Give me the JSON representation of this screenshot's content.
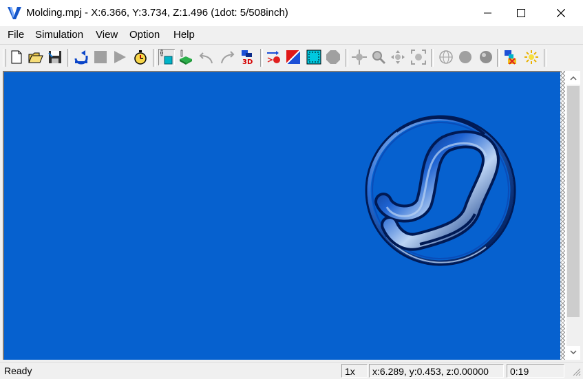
{
  "window": {
    "title": "Molding.mpj - X:6.366, Y:3.734, Z:1.496 (1dot: 5/508inch)",
    "app_icon": "v-logo-icon",
    "controls": [
      "minimize-icon",
      "maximize-icon",
      "close-icon"
    ]
  },
  "menu": {
    "items": [
      {
        "label": "File"
      },
      {
        "label": "Simulation"
      },
      {
        "label": "View"
      },
      {
        "label": "Option"
      },
      {
        "label": "Help"
      }
    ]
  },
  "toolbar": {
    "buttons": [
      {
        "icon": "new-document-icon"
      },
      {
        "icon": "open-folder-icon"
      },
      {
        "icon": "save-icon"
      },
      {
        "icon": "refresh-icon"
      },
      {
        "icon": "stop-icon"
      },
      {
        "icon": "play-icon"
      },
      {
        "icon": "stopwatch-icon"
      },
      {
        "icon": "tool-view-icon",
        "pressed": true
      },
      {
        "icon": "tool-solid-icon"
      },
      {
        "icon": "rotate-left-icon"
      },
      {
        "icon": "rotate-right-icon"
      },
      {
        "icon": "view-3d-icon",
        "label": "3D"
      },
      {
        "icon": "toolpath-icon"
      },
      {
        "icon": "color-split-icon"
      },
      {
        "icon": "select-region-icon"
      },
      {
        "icon": "octagon-icon"
      },
      {
        "icon": "pan-icon"
      },
      {
        "icon": "zoom-icon"
      },
      {
        "icon": "move-icon"
      },
      {
        "icon": "fit-icon"
      },
      {
        "icon": "sphere-wire-icon"
      },
      {
        "icon": "sphere-flat-icon"
      },
      {
        "icon": "sphere-shaded-icon"
      },
      {
        "icon": "color-settings-icon"
      },
      {
        "icon": "light-icon"
      }
    ]
  },
  "status": {
    "ready_text": "Ready",
    "zoom": "1x",
    "coords": "x:6.289, y:0.453, z:0.00000",
    "time": "0:19"
  },
  "colors": {
    "viewport_bg": "#0661cf",
    "part_highlight": "#bcd4f4",
    "part_shadow": "#001a55"
  }
}
